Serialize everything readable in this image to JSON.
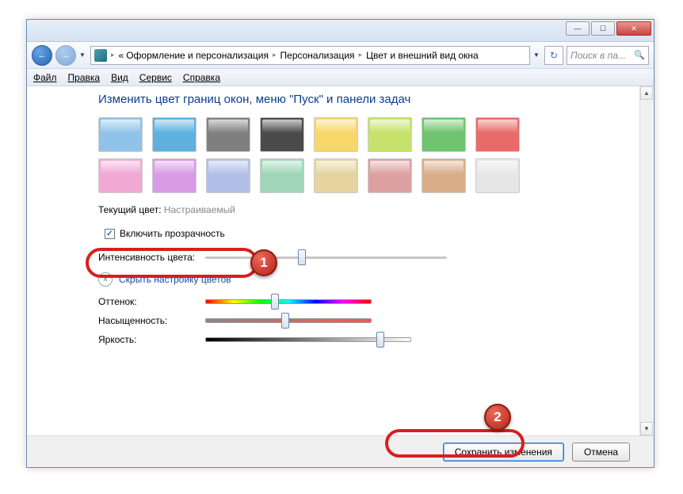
{
  "titlebar": {
    "min": "—",
    "max": "☐",
    "close": "✕"
  },
  "breadcrumb": {
    "prefix": "«",
    "items": [
      "Оформление и персонализация",
      "Персонализация",
      "Цвет и внешний вид окна"
    ]
  },
  "search": {
    "placeholder": "Поиск в па..."
  },
  "menu": {
    "file": "Файл",
    "edit": "Правка",
    "view": "Вид",
    "tools": "Сервис",
    "help": "Справка"
  },
  "heading": "Изменить цвет границ окон, меню \"Пуск\" и панели задач",
  "swatches": {
    "row1": [
      "#8fc3e8",
      "#5eb0de",
      "#7f7f7f",
      "#4a4a4a",
      "#f7d66a",
      "#c7e26b",
      "#6fc36e",
      "#e86a6a"
    ],
    "row2": [
      "#f1a9d4",
      "#d89be6",
      "#b2bfe6",
      "#9fd6b8",
      "#e5d3a0",
      "#dca0a0",
      "#d7ae88",
      "#e6e6e6"
    ]
  },
  "current": {
    "label": "Текущий цвет:",
    "value": "Настраиваемый"
  },
  "transparency": {
    "label": "Включить прозрачность",
    "checked": true
  },
  "intensity": {
    "label": "Интенсивность цвета:",
    "value": 40,
    "track_w": 305
  },
  "expander": {
    "label": "Скрыть настройку цветов"
  },
  "hue": {
    "label": "Оттенок:",
    "value": 42,
    "track_w": 210
  },
  "saturation": {
    "label": "Насыщенность:",
    "value": 48,
    "track_w": 210
  },
  "brightness": {
    "label": "Яркость:",
    "value": 85,
    "track_w": 260
  },
  "footer": {
    "save": "Сохранить изменения",
    "cancel": "Отмена"
  },
  "annotations": {
    "a1": "1",
    "a2": "2"
  }
}
